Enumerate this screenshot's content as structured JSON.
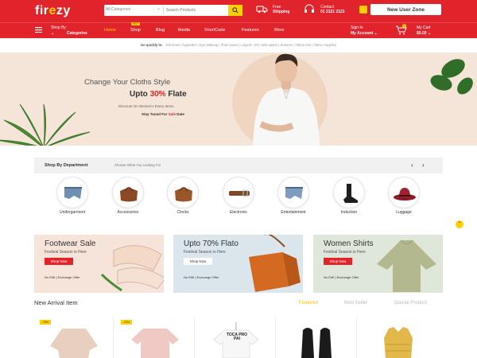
{
  "brand": {
    "logo": "fir",
    "logo_accent": "e",
    "logo_tail": "zy",
    "primary_color": "#e1232b",
    "accent_color": "#ffd000"
  },
  "search": {
    "category_label": "All Categories",
    "placeholder": "Search Products"
  },
  "topbar": {
    "shipping_line1": "Free",
    "shipping_line2": "Shipping",
    "contact_line1": "Contact",
    "contact_line2": "01 2121 2121",
    "new_user_label": "New User Zone"
  },
  "nav": {
    "shop_by": "Shop By",
    "categories": "Categories",
    "links": [
      "Home",
      "Shop",
      "Blog",
      "Media",
      "ShortCode",
      "Features",
      "More"
    ],
    "hot_badge": "HOT",
    "sign_in": "Sign In",
    "my_account": "My Account",
    "cart_label": "My Cart",
    "cart_total": "$0.00",
    "cart_count": "0"
  },
  "quick_links": {
    "label": "Go quickly to:",
    "items": [
      "Electronic Cigarettes",
      "Eye Makeup",
      "iPad Cases",
      "Lingerie",
      "RC Helicopters",
      "Summer",
      "Tattoo Kits",
      "Tattoo Supplies"
    ]
  },
  "hero": {
    "headline": "Change Your Cloths Style",
    "offer_prefix": "Upto",
    "offer_percent": "30%",
    "offer_suffix": "Flate",
    "subtext": "Discount On Women's Every Items",
    "tuned_prefix": "Stay Tuned For",
    "tuned_highlight": "Sale",
    "tuned_suffix": "Date"
  },
  "department": {
    "title": "Shop By Department",
    "subtitle": "Choose What You Looking For",
    "prev_icon": "chevron-left-icon",
    "next_icon": "chevron-right-icon",
    "items": [
      "Undergarment",
      "Accessories",
      "Clocks",
      "Electronic",
      "Entertainment",
      "Induction",
      "Luggage"
    ]
  },
  "banners": [
    {
      "title": "Footwear Sale",
      "subtitle": "Festival Season is Here",
      "button": "Shop Now",
      "footer": "No EMI | Exchange Offer",
      "bg": "#f6e4da"
    },
    {
      "title": "Upto 70% Flato",
      "subtitle": "Festival Season is Here",
      "button": "Shop Now",
      "footer": "No EMI | Exchange Offer",
      "bg": "#dbe5ec"
    },
    {
      "title": "Women Shirts",
      "subtitle": "Festival Season is Here",
      "button": "Shop Now",
      "footer": "No EMI | Exchange Offer",
      "bg": "#dfe6da"
    }
  ],
  "new_arrival": {
    "title": "New Arrival Item",
    "tabs": [
      "Featured",
      "Best Seller",
      "Special Product"
    ],
    "products": [
      {
        "badge": "-15%"
      },
      {
        "badge": "-24%"
      },
      {
        "badge": ""
      },
      {
        "badge": ""
      },
      {
        "badge": ""
      }
    ],
    "tee_print": "TOCA PRO PAI"
  }
}
